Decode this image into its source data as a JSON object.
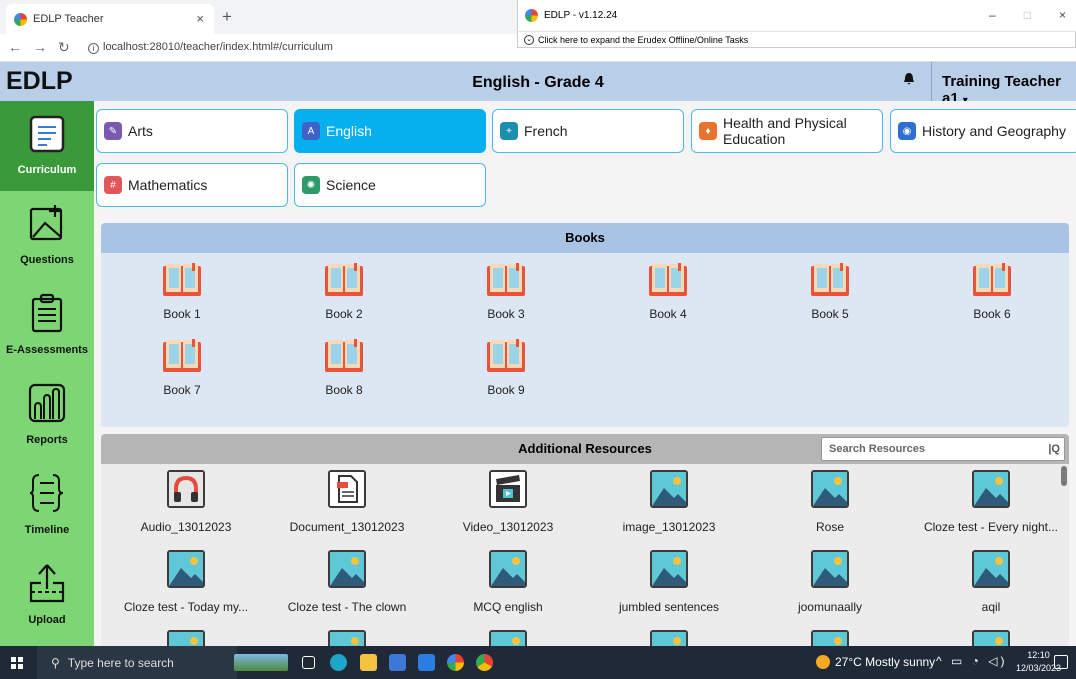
{
  "browser": {
    "tab_title": "EDLP Teacher",
    "tab_close": "×",
    "new_tab": "+",
    "url": "localhost:28010/teacher/index.html#/curriculum"
  },
  "overlay": {
    "title": "EDLP - v1.12.24",
    "expand_text": "Click here to expand the Erudex Offline/Online Tasks",
    "minimize": "–",
    "maximize": "□",
    "close": "×"
  },
  "header": {
    "logo": "EDLP",
    "title": "English - Grade 4",
    "user": "Training Teacher a1"
  },
  "sidebar": {
    "items": [
      {
        "label": "Curriculum",
        "icon": "curriculum-icon",
        "active": true
      },
      {
        "label": "Questions",
        "icon": "add-question-icon"
      },
      {
        "label": "E-Assessments",
        "icon": "clipboard-icon"
      },
      {
        "label": "Reports",
        "icon": "reports-icon"
      },
      {
        "label": "Timeline",
        "icon": "timeline-icon"
      },
      {
        "label": "Upload",
        "icon": "upload-icon"
      }
    ]
  },
  "subjects": [
    {
      "label": "Arts",
      "color": "#7a5ab0"
    },
    {
      "label": "English",
      "color": "#3d63c9",
      "active": true
    },
    {
      "label": "French",
      "color": "#1b8fb0"
    },
    {
      "label_1": "Health and Physical",
      "label_2": "Education",
      "color": "#e8732c"
    },
    {
      "label": "History and Geography",
      "color": "#2e6fd0"
    },
    {
      "label": "Mathematics",
      "color": "#e2565a"
    },
    {
      "label": "Science",
      "color": "#2e9a6a"
    }
  ],
  "books": {
    "title": "Books",
    "items": [
      "Book 1",
      "Book 2",
      "Book 3",
      "Book 4",
      "Book 5",
      "Book 6",
      "Book 7",
      "Book 8",
      "Book 9"
    ]
  },
  "resources": {
    "title": "Additional Resources",
    "search_placeholder": "Search Resources",
    "items": [
      {
        "label": "Audio_13012023",
        "icon": "headphones-icon"
      },
      {
        "label": "Document_13012023",
        "icon": "document-icon"
      },
      {
        "label": "Video_13012023",
        "icon": "clapperboard-icon"
      },
      {
        "label": "image_13012023",
        "icon": "image-icon"
      },
      {
        "label": "Rose",
        "icon": "image-icon"
      },
      {
        "label": "Cloze test - Every night...",
        "icon": "image-icon"
      },
      {
        "label": "Cloze test - Today my...",
        "icon": "image-icon"
      },
      {
        "label": "Cloze test - The clown",
        "icon": "image-icon"
      },
      {
        "label": "MCQ english",
        "icon": "image-icon"
      },
      {
        "label": "jumbled sentences",
        "icon": "image-icon"
      },
      {
        "label": "joomunaally",
        "icon": "image-icon"
      },
      {
        "label": "aqil",
        "icon": "image-icon"
      }
    ]
  },
  "taskbar": {
    "search_placeholder": "Type here to search",
    "weather": "27°C  Mostly sunny",
    "time": "12:10",
    "date": "12/03/2023"
  }
}
